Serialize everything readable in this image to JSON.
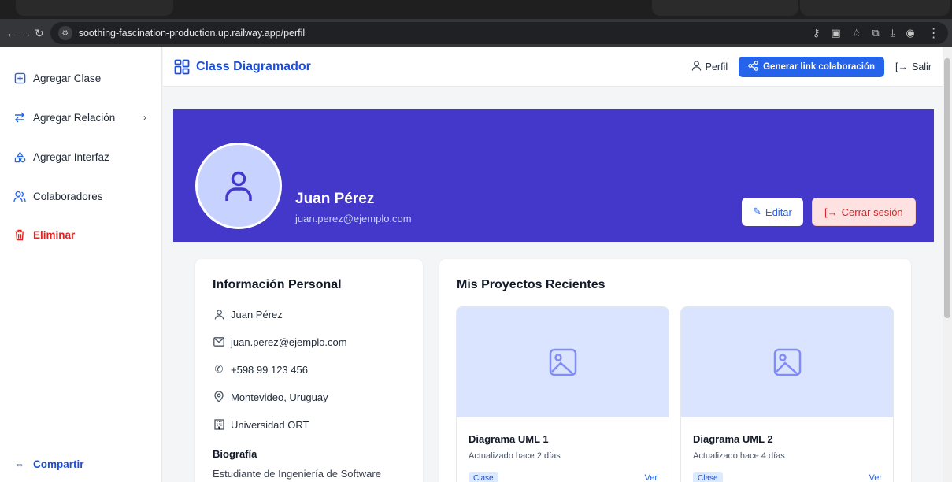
{
  "browser": {
    "url": "soothing-fascination-production.up.railway.app/perfil"
  },
  "sidebar": {
    "items": [
      {
        "label": "Agregar Clase",
        "icon": "plus-square-icon"
      },
      {
        "label": "Agregar Relación",
        "icon": "arrows-exchange-icon"
      },
      {
        "label": "Agregar Interfaz",
        "icon": "shapes-icon"
      },
      {
        "label": "Colaboradores",
        "icon": "users-icon"
      },
      {
        "label": "Eliminar",
        "icon": "trash-icon"
      }
    ],
    "share_label": "Compartir"
  },
  "header": {
    "brand": "Class Diagramador",
    "profile_label": "Perfil",
    "collab_button": "Generar link colaboración",
    "logout_label": "Salir"
  },
  "profile": {
    "name": "Juan Pérez",
    "email": "juan.perez@ejemplo.com",
    "edit_button": "Editar",
    "logout_button": "Cerrar sesión"
  },
  "personal_info": {
    "title": "Información Personal",
    "name": "Juan Pérez",
    "email": "juan.perez@ejemplo.com",
    "phone": "+598 99 123 456",
    "location": "Montevideo, Uruguay",
    "institution": "Universidad ORT",
    "bio_title": "Biografía",
    "bio_text": "Estudiante de Ingeniería de Software"
  },
  "projects": {
    "title": "Mis Proyectos Recientes",
    "items": [
      {
        "title": "Diagrama UML 1",
        "updated": "Actualizado hace 2 días",
        "tag": "Clase",
        "action": "Ver"
      },
      {
        "title": "Diagrama UML 2",
        "updated": "Actualizado hace 4 días",
        "tag": "Clase",
        "action": "Ver"
      }
    ]
  },
  "colors": {
    "primary": "#2563eb",
    "hero": "#4338ca",
    "danger": "#dc2626"
  }
}
